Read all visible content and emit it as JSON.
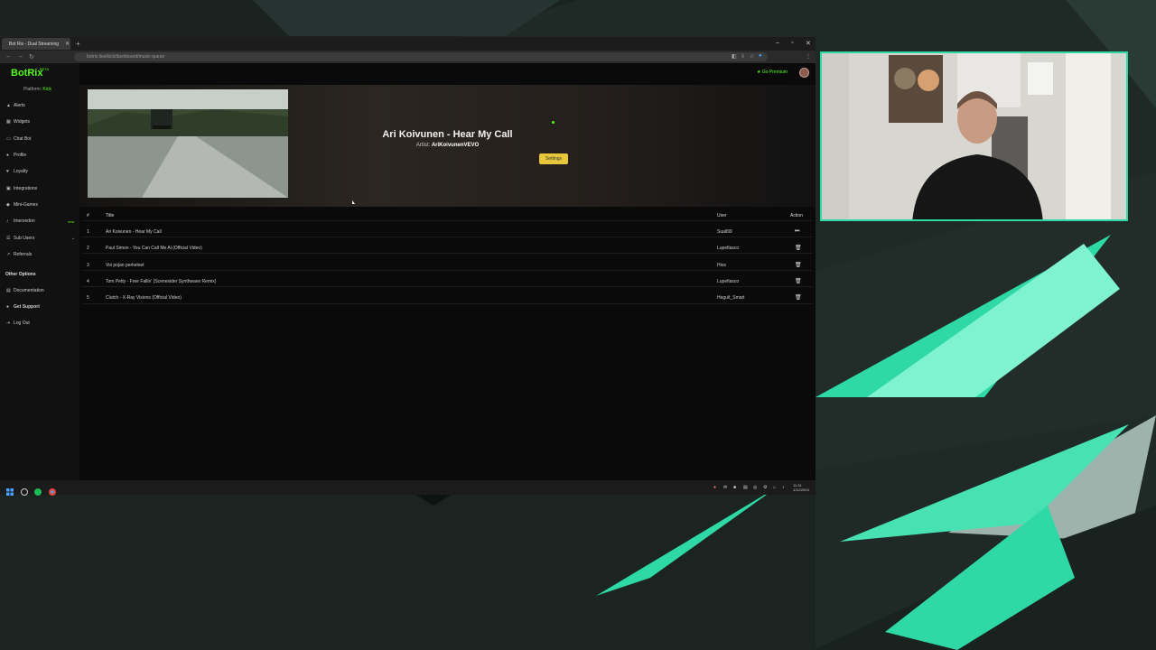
{
  "colors": {
    "accent": "#53fc18",
    "brand_teal": "#2fd9a6",
    "button": "#e6c63a"
  },
  "browser": {
    "tab_title": "Bot Rix - Dual Streaming",
    "url": "botrix.live/kick/dashboard/music-queue"
  },
  "app": {
    "logo_text": "BotRix",
    "logo_beta": "BETA",
    "platform_label": "Platform:",
    "platform_value": "Kick",
    "premium_label": "Go Premium",
    "nav": [
      {
        "label": "Alerts",
        "icon": "bell-icon"
      },
      {
        "label": "Widgets",
        "icon": "widget-icon"
      },
      {
        "label": "Chat Bot",
        "icon": "chat-icon"
      },
      {
        "label": "Profile",
        "icon": "user-icon"
      },
      {
        "label": "Loyalty",
        "icon": "heart-icon"
      },
      {
        "label": "Integrations",
        "icon": "plug-icon"
      },
      {
        "label": "Mini-Games",
        "icon": "gamepad-icon"
      },
      {
        "label": "Imerzedon",
        "icon": "music-icon",
        "badge": "new"
      },
      {
        "label": "Sub Users",
        "icon": "users-icon"
      },
      {
        "label": "Referrals",
        "icon": "link-icon"
      }
    ],
    "other_options_title": "Other Options",
    "other_nav": [
      {
        "label": "Documentation",
        "icon": "doc-icon"
      },
      {
        "label": "Get Support",
        "icon": "support-icon"
      },
      {
        "label": "Log Out",
        "icon": "logout-icon"
      }
    ]
  },
  "now_playing": {
    "title": "Ari Koivunen - Hear My Call",
    "artist_label": "Artist:",
    "artist": "AriKoivunenVEVO",
    "settings_label": "Settings"
  },
  "queue": {
    "headers": {
      "num": "#",
      "title": "Title",
      "user": "User",
      "action": "Action"
    },
    "rows": [
      {
        "num": "1",
        "title": "Ari Koivunen - Hear My Call",
        "user": "Suall99",
        "action": "skip-icon"
      },
      {
        "num": "2",
        "title": "Paul Simon - You Can Call Me Al (Official Video)",
        "user": "Lupefiasco",
        "action": "trash-icon"
      },
      {
        "num": "3",
        "title": "Voi pojan perkeleet",
        "user": "Hios",
        "action": "trash-icon"
      },
      {
        "num": "4",
        "title": "Tom Petty - Free Fallin' (Scenesider Synthwave Remix)",
        "user": "Lupefiasco",
        "action": "trash-icon"
      },
      {
        "num": "5",
        "title": "Clutch - X-Ray Visions (Official Video)",
        "user": "Hegult_Smart",
        "action": "trash-icon"
      }
    ]
  },
  "taskbar": {
    "clock_time": "11:31",
    "clock_date": "1/12/2024"
  }
}
